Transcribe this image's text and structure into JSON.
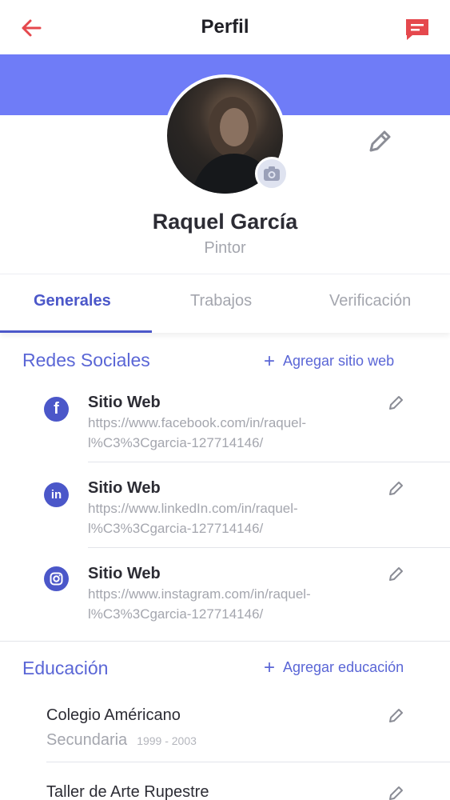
{
  "header": {
    "title": "Perfil"
  },
  "profile": {
    "name": "Raquel García",
    "role": "Pintor"
  },
  "tabs": [
    {
      "label": "Generales",
      "active": true
    },
    {
      "label": "Trabajos",
      "active": false
    },
    {
      "label": "Verificación",
      "active": false
    }
  ],
  "social": {
    "title": "Redes Sociales",
    "add_label": "Agregar sitio web",
    "items": [
      {
        "icon": "facebook-icon",
        "title": "Sitio Web",
        "url_line1": "https://www.facebook.com/in/raquel-",
        "url_line2": "l%C3%3Cgarcia-127714146/"
      },
      {
        "icon": "linkedin-icon",
        "title": "Sitio Web",
        "url_line1": "https://www.linkedIn.com/in/raquel-",
        "url_line2": "l%C3%3Cgarcia-127714146/"
      },
      {
        "icon": "instagram-icon",
        "title": "Sitio Web",
        "url_line1": "https://www.instagram.com/in/raquel-",
        "url_line2": "l%C3%3Cgarcia-127714146/"
      }
    ]
  },
  "education": {
    "title": "Educación",
    "add_label": "Agregar educación",
    "items": [
      {
        "title": "Colegio Américano",
        "level": "Secundaria",
        "years": "1999 - 2003"
      },
      {
        "title": "Taller de Arte Rupestre"
      }
    ]
  },
  "colors": {
    "accent": "#4b57c9",
    "banner": "#6f7cf7",
    "header_icons": "#e5484d"
  }
}
